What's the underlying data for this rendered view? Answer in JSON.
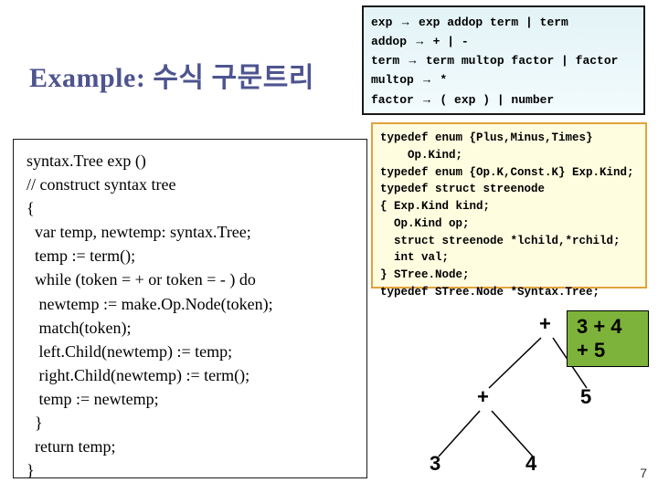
{
  "title": "Example: 수식 구문트리",
  "grammar": {
    "l1a": "exp ",
    "l1arrow": "→",
    "l1b": " exp addop term | term",
    "l2a": "addop ",
    "l2arrow": "→",
    "l2b": " + | -",
    "l3a": "term ",
    "l3arrow": "→",
    "l3b": " term multop factor | factor",
    "l4a": "multop ",
    "l4arrow": "→",
    "l4b": " *",
    "l5a": "factor ",
    "l5arrow": "→",
    "l5b": " ( exp ) | number"
  },
  "code": "syntax.Tree exp ()\n// construct syntax tree\n{\n  var temp, newtemp: syntax.Tree;\n  temp := term();\n  while (token = + or token = - ) do\n   newtemp := make.Op.Node(token);\n   match(token);\n   left.Child(newtemp) := temp;\n   right.Child(newtemp) := term();\n   temp := newtemp;\n  }\n  return temp;\n}",
  "typedef": "typedef enum {Plus,Minus,Times}\n    Op.Kind;\ntypedef enum {Op.K,Const.K} Exp.Kind;\ntypedef struct streenode\n{ Exp.Kind kind;\n  Op.Kind op;\n  struct streenode *lchild,*rchild;\n  int val;\n} STree.Node;\ntypedef STree.Node *Syntax.Tree;",
  "tree": {
    "root": "+",
    "left": "+",
    "right": "5",
    "ll": "3",
    "lr": "4"
  },
  "expr": "3 + 4 + 5",
  "page": "7"
}
